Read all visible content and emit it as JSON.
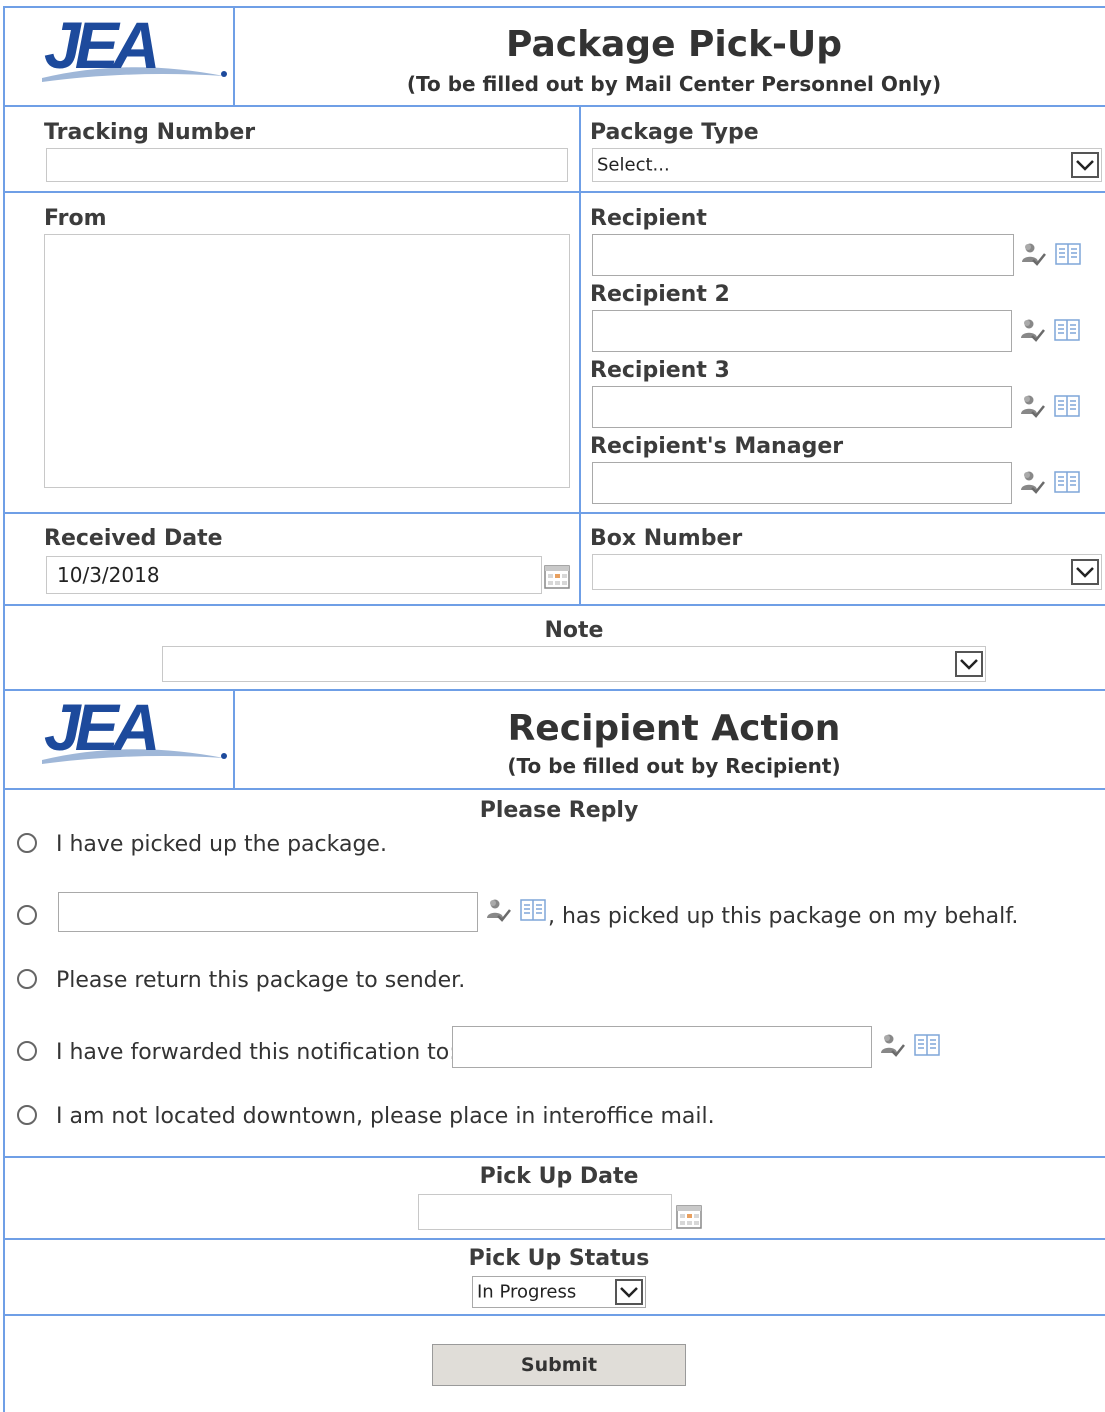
{
  "header": {
    "logo_text": "JEA",
    "title": "Package Pick-Up",
    "subtitle": "(To be filled out by Mail Center Personnel Only)"
  },
  "fields": {
    "tracking_number": {
      "label": "Tracking Number",
      "value": ""
    },
    "package_type": {
      "label": "Package Type",
      "value": "Select..."
    },
    "from": {
      "label": "From",
      "value": ""
    },
    "recipient": {
      "label": "Recipient",
      "value": ""
    },
    "recipient2": {
      "label": "Recipient 2",
      "value": ""
    },
    "recipient3": {
      "label": "Recipient 3",
      "value": ""
    },
    "recipient_manager": {
      "label": "Recipient's Manager",
      "value": ""
    },
    "received_date": {
      "label": "Received Date",
      "value": "10/3/2018"
    },
    "box_number": {
      "label": "Box Number",
      "value": ""
    },
    "note": {
      "label": "Note",
      "value": ""
    }
  },
  "recipient_action": {
    "logo_text": "JEA",
    "title": "Recipient Action",
    "subtitle": "(To be filled out by Recipient)",
    "reply_label": "Please Reply",
    "options": {
      "picked_up": "I have picked up the package.",
      "behalf_suffix": ", has picked up this package on my behalf.",
      "return": "Please return this package to sender.",
      "forwarded": "I have forwarded this notification to:",
      "interoffice": "I am not located downtown, please place in interoffice mail."
    }
  },
  "pickup": {
    "date_label": "Pick Up Date",
    "date_value": "",
    "status_label": "Pick Up Status",
    "status_value": "In Progress"
  },
  "submit_label": "Submit",
  "colors": {
    "border": "#6f9fe6",
    "logo_blue": "#1d4a9c",
    "button_bg": "#e0ddd8"
  }
}
